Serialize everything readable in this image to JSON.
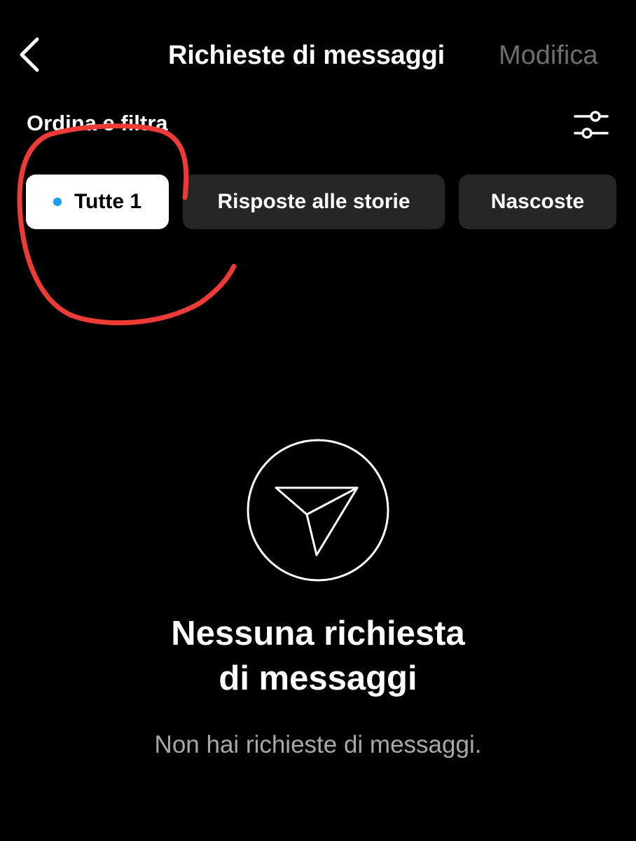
{
  "header": {
    "title": "Richieste di messaggi",
    "edit_label": "Modifica"
  },
  "filters": {
    "label": "Ordina e filtra",
    "icon": "sliders-icon",
    "chips": [
      {
        "label": "Tutte 1",
        "selected": true,
        "unread_dot_color": "#1d9bf0"
      },
      {
        "label": "Risposte alle storie",
        "selected": false
      },
      {
        "label": "Nascoste",
        "selected": false
      }
    ]
  },
  "empty_state": {
    "icon": "paper-plane-icon",
    "title_line1": "Nessuna richiesta",
    "title_line2": "di messaggi",
    "subtitle": "Non hai richieste di messaggi."
  },
  "colors": {
    "background": "#000000",
    "chip_selected": "#ffffff",
    "chip_unselected": "#262626",
    "muted_text": "#6e6e6e",
    "annotation": "#ef3b36"
  }
}
